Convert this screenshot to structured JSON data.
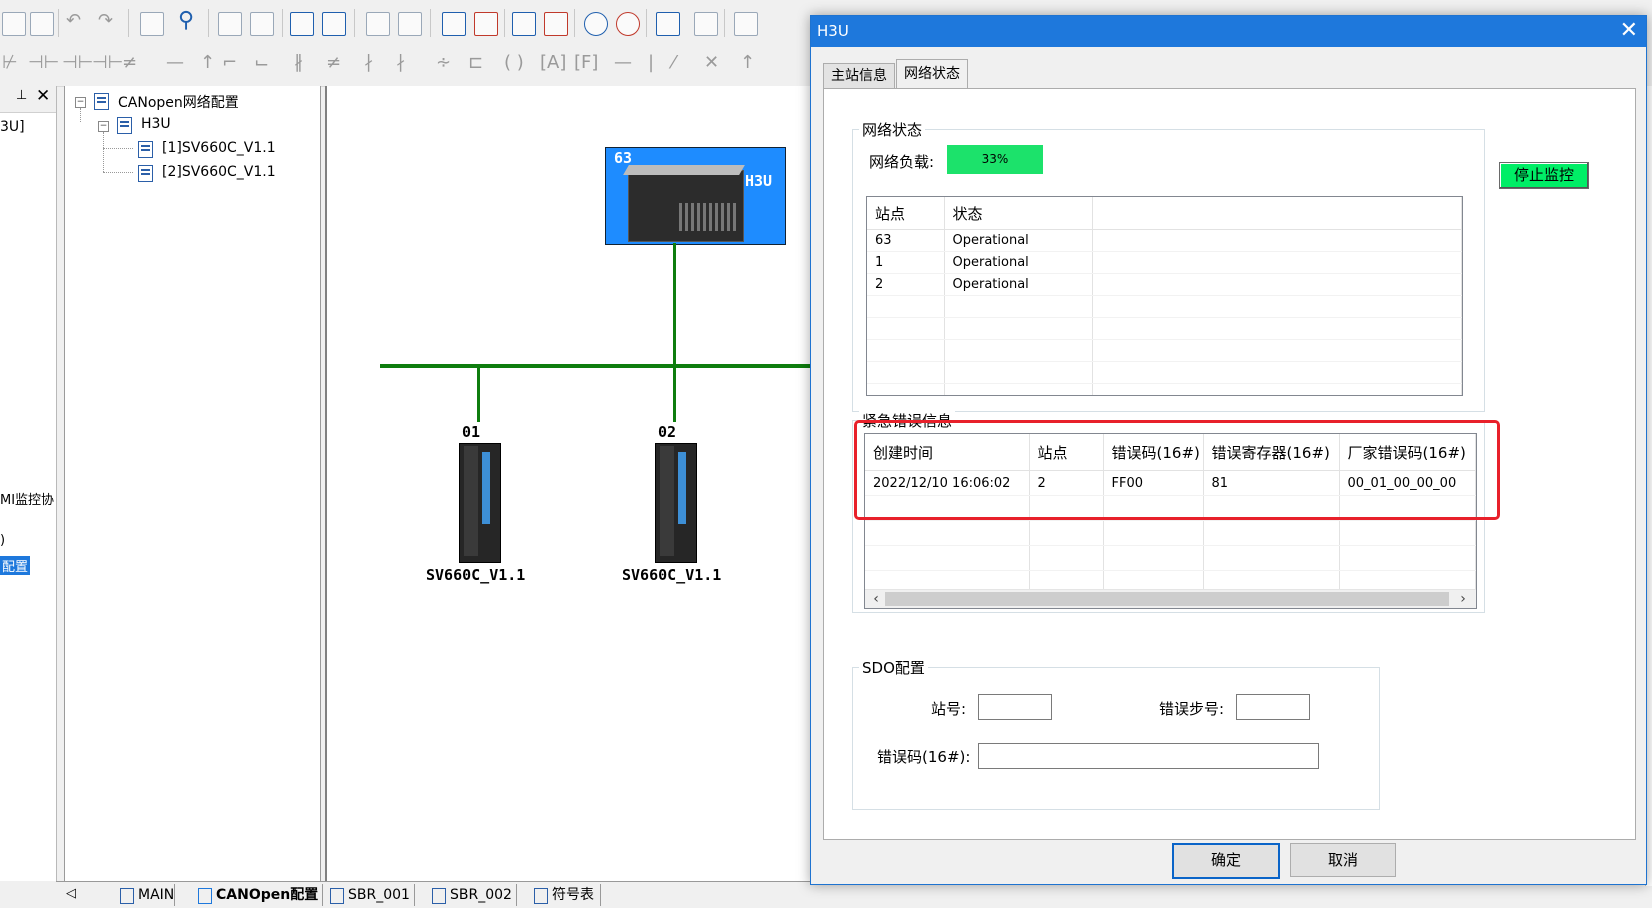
{
  "background": {
    "left_pane": {
      "partial_texts": [
        "3U]",
        "MI监控协",
        ")",
        "配置"
      ]
    },
    "tree": {
      "root": "CANopen网络配置",
      "master": "H3U",
      "slaves": [
        "[1]SV660C_V1.1",
        "[2]SV660C_V1.1"
      ]
    },
    "network": {
      "master_node": "63",
      "master_label": "H3U",
      "slaves": [
        {
          "id": "01",
          "name": "SV660C_V1.1"
        },
        {
          "id": "02",
          "name": "SV660C_V1.1"
        }
      ]
    },
    "bottom_tabs": [
      "MAIN",
      "CANOpen配置",
      "SBR_001",
      "SBR_002",
      "符号表"
    ],
    "colors": {
      "bus": "#0e7d0e",
      "master_bg": "#1e8cff"
    }
  },
  "dialog": {
    "title": "H3U",
    "tabs": [
      "主站信息",
      "网络状态"
    ],
    "active_tab": "网络状态",
    "network_status": {
      "group_title": "网络状态",
      "load_label": "网络负载:",
      "load_value": "33%",
      "load_color": "#1ce26b",
      "stop_button": "停止监控",
      "columns": [
        "站点",
        "状态"
      ],
      "rows": [
        [
          "63",
          "Operational"
        ],
        [
          "1",
          "Operational"
        ],
        [
          "2",
          "Operational"
        ]
      ]
    },
    "emergency": {
      "group_title": "紧急错误信息",
      "columns": [
        "创建时间",
        "站点",
        "错误码(16#)",
        "错误寄存器(16#)",
        "厂家错误码(16#)"
      ],
      "rows": [
        [
          "2022/12/10 16:06:02",
          "2",
          "FF00",
          "81",
          "00_01_00_00_00"
        ]
      ],
      "highlight_color": "#e8202a"
    },
    "sdo": {
      "group_title": "SDO配置",
      "station_label": "站号:",
      "station_value": "",
      "error_step_label": "错误步号:",
      "error_step_value": "",
      "error_code_label": "错误码(16#):",
      "error_code_value": ""
    },
    "ok_button": "确定",
    "cancel_button": "取消"
  }
}
